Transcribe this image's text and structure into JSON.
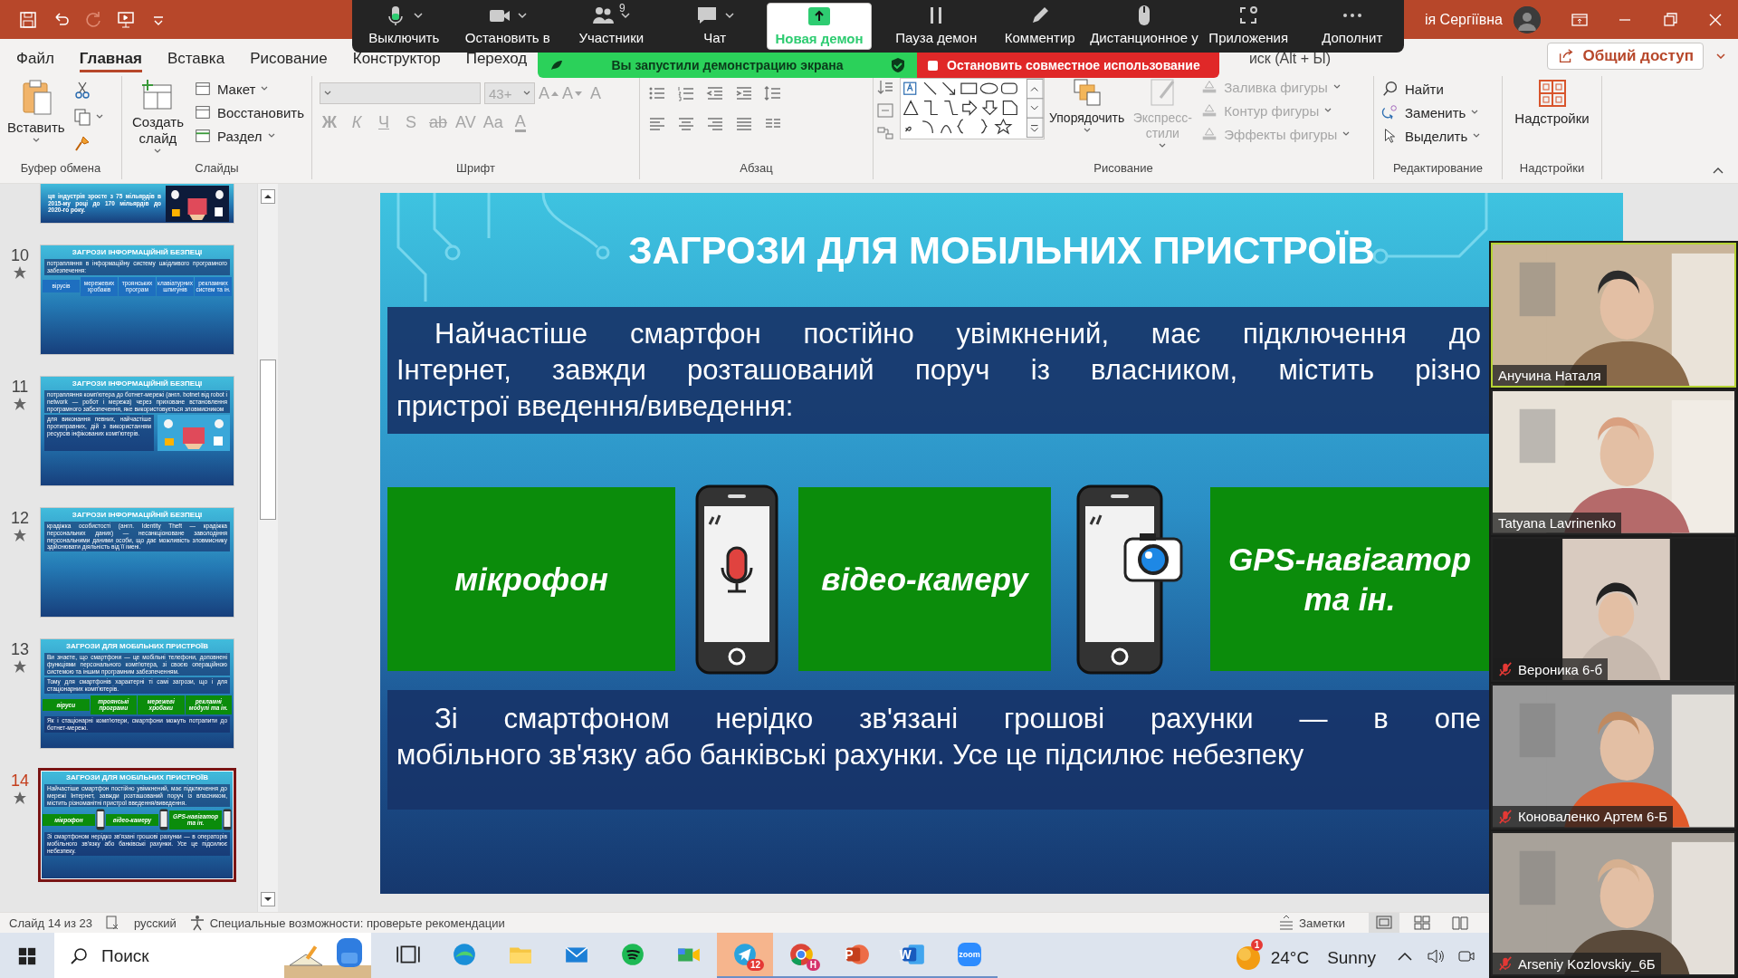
{
  "title_bar": {
    "user_name": "ія Сергіївна"
  },
  "menu_tabs": [
    {
      "label": "Файл",
      "selected": false
    },
    {
      "label": "Главная",
      "selected": true
    },
    {
      "label": "Вставка",
      "selected": false
    },
    {
      "label": "Рисование",
      "selected": false
    },
    {
      "label": "Конструктор",
      "selected": false
    },
    {
      "label": "Переход",
      "selected": false
    }
  ],
  "tell_me": "иск (Alt + Ы)",
  "share_button": "Общий доступ",
  "ribbon": {
    "clipboard": {
      "label": "Буфер обмена",
      "paste": "Вставить"
    },
    "slides": {
      "label": "Слайды",
      "new_slide": "Создать слайд",
      "items": [
        "Макет",
        "Восстановить",
        "Раздел"
      ]
    },
    "font": {
      "label": "Шрифт",
      "size": "43+",
      "disabled": true,
      "top_buttons": [
        {
          "glyph": "A",
          "kind": "grow"
        },
        {
          "glyph": "A",
          "kind": "shrink"
        },
        {
          "glyph": "A",
          "kind": "clear"
        }
      ],
      "format_buttons": [
        {
          "glyph": "Ж",
          "kind": "bold"
        },
        {
          "glyph": "К",
          "kind": "italic"
        },
        {
          "glyph": "Ч",
          "kind": "underline"
        },
        {
          "glyph": "S",
          "kind": "shadow"
        },
        {
          "glyph": "ab",
          "kind": "strike"
        },
        {
          "glyph": "AV",
          "kind": "spacing"
        },
        {
          "glyph": "Aa",
          "kind": "case"
        },
        {
          "glyph": "A",
          "kind": "color"
        }
      ]
    },
    "paragraph": {
      "label": "Абзац"
    },
    "drawing": {
      "label": "Рисование",
      "arrange": "Упорядочить",
      "quick_styles": {
        "label": "Экспресс-стили",
        "disabled": true
      },
      "items": [
        {
          "label": "Заливка фигуры",
          "disabled": true
        },
        {
          "label": "Контур фигуры",
          "disabled": true
        },
        {
          "label": "Эффекты фигуры",
          "disabled": true
        }
      ]
    },
    "editing": {
      "label": "Редактирование",
      "items": [
        "Найти",
        "Заменить",
        "Выделить"
      ]
    },
    "addins": {
      "label": "Надстройки",
      "button": "Надстройки"
    }
  },
  "zoom_toolbar": {
    "items": [
      {
        "label": "Выключить",
        "kind": "mic"
      },
      {
        "label": "Остановить в",
        "kind": "video"
      },
      {
        "label": "Участники",
        "kind": "participants",
        "count": "9"
      },
      {
        "label": "Чат",
        "kind": "chat"
      },
      {
        "label": "Новая демон",
        "kind": "share"
      },
      {
        "label": "Пауза демон",
        "kind": "pause"
      },
      {
        "label": "Комментир",
        "kind": "annotate"
      },
      {
        "label": "Дистанционное у",
        "kind": "remote"
      },
      {
        "label": "Приложения",
        "kind": "apps"
      },
      {
        "label": "Дополнит",
        "kind": "more"
      }
    ]
  },
  "share_banner": {
    "message": "Вы запустили демонстрацию экрана",
    "stop": "Остановить совместное использование"
  },
  "thumbnails": [
    {
      "selected": false,
      "partial": true,
      "paragraphs": [
        "ця індустрія зросте з 75 мільярдів в 2015-му році до 170 мільярдів до 2020-го року."
      ],
      "picture": true
    },
    {
      "number": "10",
      "selected": false,
      "title": "ЗАГРОЗИ ІНФОРМАЦІЙНІЙ БЕЗПЕЦІ",
      "paragraphs": [
        "потрапляння в інформаційну систему шкідливого програмного забезпечення:"
      ],
      "boxes": [
        {
          "text": "вірусів",
          "kind": "blue"
        },
        {
          "text": "мережевих хробаків",
          "kind": "blue"
        },
        {
          "text": "троянських програм",
          "kind": "blue"
        },
        {
          "text": "клавіатурних шпигунів",
          "kind": "blue"
        },
        {
          "text": "рекламних систем та ін.",
          "kind": "blue"
        }
      ]
    },
    {
      "number": "11",
      "selected": false,
      "title": "ЗАГРОЗИ ІНФОРМАЦІЙНІЙ БЕЗПЕЦІ",
      "paragraphs": [
        "потрапляння комп'ютера до ботнет-мережі (англ. botnet від robot і network — робот і мережа) через приховане встановлення програмного забезпечення, яке використовується зловмисником"
      ],
      "closing": "для виконання певних, найчастіше протиправних, дій з використанням ресурсів інфікованих комп'ютерів.",
      "picture": true
    },
    {
      "number": "12",
      "selected": false,
      "title": "ЗАГРОЗИ ІНФОРМАЦІЙНІЙ БЕЗПЕЦІ",
      "paragraphs": [
        "крадіжка особистості (англ. Identity Theft — крадіжка персональних даних) — несанкціоноване заволодіння персональними даними особи, що дає можливість зловмиснику здійснювати діяльність від її імені."
      ]
    },
    {
      "number": "13",
      "selected": false,
      "title": "ЗАГРОЗИ ДЛЯ МОБІЛЬНИХ ПРИСТРОЇВ",
      "paragraphs": [
        "Ви знаєте, що смартфони — це мобільні телефони, доповнені функціями персонального комп'ютера, зі своєю операційною системою та іншим програмним забезпеченням.",
        "Тому для смартфонів характерні ті самі загрози, що і для стаціонарних комп'ютерів."
      ],
      "boxes": [
        {
          "text": "віруси",
          "kind": "green"
        },
        {
          "text": "троянські програми",
          "kind": "green"
        },
        {
          "text": "мережеві хробаки",
          "kind": "green"
        },
        {
          "text": "рекламні модулі та ін.",
          "kind": "green"
        }
      ],
      "closing": "Як і стаціонарні комп'ютери, смартфони можуть потрапити до ботнет-мережі."
    },
    {
      "number": "14",
      "selected": true,
      "title": "ЗАГРОЗИ ДЛЯ МОБІЛЬНИХ ПРИСТРОЇВ",
      "paragraphs": [
        "Найчастіше смартфон постійно увімкнений, має підключення до мережі Інтернет, завжди розташований поруч із власником, містить різноманітні пристрої введення/виведення."
      ],
      "boxes": [
        {
          "text": "мікрофон",
          "kind": "green"
        },
        {
          "kind": "phone"
        },
        {
          "text": "відео-камеру",
          "kind": "green"
        },
        {
          "kind": "phone"
        },
        {
          "text": "GPS-навігатор та ін.",
          "kind": "green"
        },
        {
          "kind": "phone"
        }
      ],
      "closing": "Зі смартфоном нерідко зв'язані грошові рахунки — в операторів мобільного зв'язку або банківські рахунки. Усе це підсилює небезпеку."
    }
  ],
  "slide": {
    "title": "ЗАГРОЗИ ДЛЯ МОБІЛЬНИХ ПРИСТРОЇВ",
    "intro_lines": [
      "Найчастіше смартфон постійно увімкнений, має підключення до",
      "Інтернет, завжди розташований поруч із власником, містить різно",
      "пристрої введення/виведення:"
    ],
    "devices": [
      {
        "kind": "label",
        "text": "мікрофон"
      },
      {
        "kind": "mic-phone"
      },
      {
        "kind": "label",
        "text": "відео-камеру"
      },
      {
        "kind": "camera-phone"
      },
      {
        "kind": "label",
        "text": "GPS-навігатор та ін."
      }
    ],
    "outro_lines": [
      "Зі смартфоном нерідко зв'язані грошові рахунки — в опе",
      "мобільного зв'язку або банківські рахунки. Усе це підсилює небезпеку"
    ]
  },
  "participants": [
    {
      "name": "Анучина Наталя",
      "muted": false,
      "speaking": true
    },
    {
      "name": "Tatyana Lavrinenko",
      "muted": false,
      "speaking": false
    },
    {
      "name": "Вероника 6-б",
      "muted": true,
      "speaking": false
    },
    {
      "name": "Коноваленко Артем 6-Б",
      "muted": true,
      "speaking": false
    },
    {
      "name": "Arseniy Kozlovskiy_6Б",
      "muted": true,
      "speaking": false
    }
  ],
  "status_bar": {
    "slide_info": "Слайд 14 из 23",
    "language": "русский",
    "accessibility": "Специальные возможности: проверьте рекомендации",
    "notes": "Заметки"
  },
  "taskbar": {
    "search_label": "Поиск",
    "apps": [
      {
        "kind": "task-view",
        "running": false,
        "attention": false
      },
      {
        "kind": "edge",
        "running": false,
        "attention": false
      },
      {
        "kind": "explorer",
        "running": false,
        "attention": false
      },
      {
        "kind": "mail",
        "running": false,
        "attention": false
      },
      {
        "kind": "spotify",
        "running": false,
        "attention": false
      },
      {
        "kind": "meet",
        "running": false,
        "attention": false
      },
      {
        "kind": "telegram",
        "running": true,
        "attention": true,
        "badge": "12"
      },
      {
        "kind": "chrome",
        "running": true,
        "attention": false,
        "badge": "H"
      },
      {
        "kind": "powerpoint",
        "running": true,
        "attention": false,
        "glyph": "P"
      },
      {
        "kind": "word",
        "running": true,
        "attention": false,
        "glyph": "W"
      },
      {
        "kind": "zoom",
        "running": true,
        "attention": false,
        "glyph": "zoom"
      }
    ],
    "weather": {
      "badge": "1",
      "temperature": "24°C",
      "condition": "Sunny"
    }
  }
}
